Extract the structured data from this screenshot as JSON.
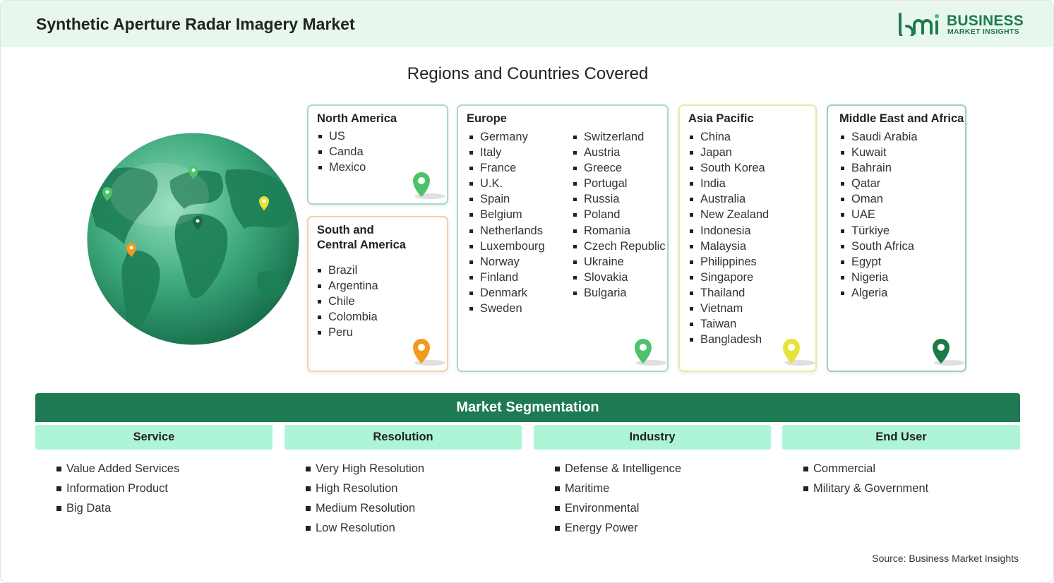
{
  "header": {
    "title": "Synthetic Aperture Radar Imagery Market",
    "logo": {
      "name": "BUSINESS",
      "sub": "MARKET INSIGHTS"
    }
  },
  "regions": {
    "title": "Regions and Countries Covered",
    "north_america": {
      "title": "North America",
      "items": [
        "US",
        "Canda",
        "Mexico"
      ]
    },
    "south_america": {
      "title_line1": "South and",
      "title_line2": "Central America",
      "items": [
        "Brazil",
        "Argentina",
        "Chile",
        "Colombia",
        "Peru"
      ]
    },
    "europe": {
      "title": "Europe",
      "col1": [
        "Germany",
        "Italy",
        "France",
        "U.K.",
        "Spain",
        "Belgium",
        "Netherlands",
        "Luxembourg",
        "Norway",
        "Finland",
        "Denmark",
        "Sweden"
      ],
      "col2": [
        "Switzerland",
        "Austria",
        "Greece",
        "Portugal",
        "Russia",
        "Poland",
        "Romania",
        "Czech Republic",
        "Ukraine",
        "Slovakia",
        "Bulgaria"
      ]
    },
    "asia_pacific": {
      "title": "Asia Pacific",
      "items": [
        "China",
        "Japan",
        "South Korea",
        "India",
        "Australia",
        "New Zealand",
        "Indonesia",
        "Malaysia",
        "Philippines",
        "Singapore",
        "Thailand",
        "Vietnam",
        "Taiwan",
        "Bangladesh"
      ]
    },
    "mea": {
      "title": "Middle East and Africa",
      "items": [
        "Saudi Arabia",
        "Kuwait",
        "Bahrain",
        "Qatar",
        "Oman",
        "UAE",
        "Türkiye",
        "South Africa",
        "Egypt",
        "Nigeria",
        "Algeria"
      ]
    }
  },
  "segmentation": {
    "title": "Market Segmentation",
    "service": {
      "label": "Service",
      "items": [
        "Value Added Services",
        "Information Product",
        "Big Data"
      ]
    },
    "resolution": {
      "label": "Resolution",
      "items": [
        "Very High Resolution",
        "High Resolution",
        "Medium Resolution",
        "Low Resolution"
      ]
    },
    "industry": {
      "label": "Industry",
      "items": [
        "Defense & Intelligence",
        "Maritime",
        "Environmental",
        "Energy Power"
      ]
    },
    "end_user": {
      "label": "End User",
      "items": [
        "Commercial",
        "Military & Government"
      ]
    }
  },
  "colors": {
    "primary_green": "#1e7a53",
    "pin_green": "#4cc36b",
    "pin_orange": "#f29a1f",
    "pin_yellow": "#e8e13a",
    "pin_dark": "#1b7a45"
  },
  "icons": {
    "globe": "globe-icon",
    "pin": "map-pin-icon"
  },
  "source": "Source: Business Market Insights"
}
